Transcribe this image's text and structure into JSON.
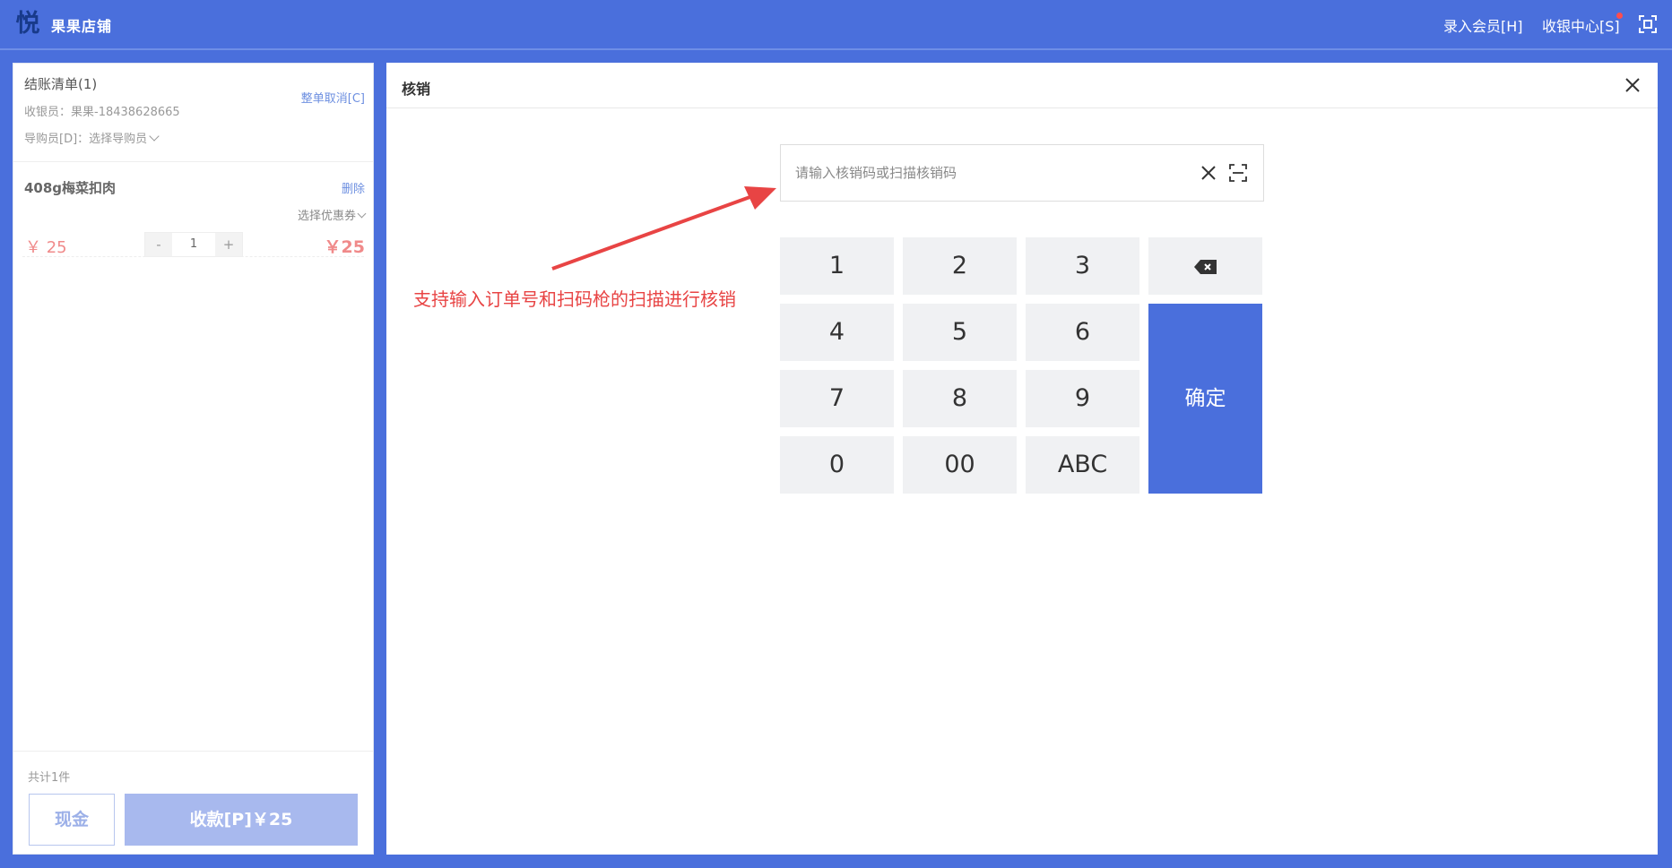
{
  "header": {
    "store_name": "果果店铺",
    "logo_char": "悦",
    "member_link": "录入会员[H]",
    "cashier_center": "收银中心[S]"
  },
  "checkout": {
    "title": "结账清单(1)",
    "cancel_all": "整单取消[C]",
    "cashier": "收银员：果果-18438628665",
    "guide": "导购员[D]：选择导购员",
    "items": [
      {
        "name": "408g梅菜扣肉",
        "delete": "删除",
        "coupon": "选择优惠券",
        "unit_price": "￥ 25",
        "quantity": "1",
        "minus": "-",
        "plus": "+",
        "total": "￥25"
      }
    ],
    "count": "共计1件",
    "cash_button": "现金",
    "pay_button": "收款[P]￥25"
  },
  "verify": {
    "title": "核销",
    "input_placeholder": "请输入核销码或扫描核销码",
    "input_value": "",
    "annotation": "支持输入订单号和扫码枪的扫描进行核销",
    "keys": [
      "1",
      "2",
      "3",
      "4",
      "5",
      "6",
      "7",
      "8",
      "9",
      "0",
      "00",
      "ABC"
    ],
    "confirm": "确定"
  },
  "colors": {
    "primary": "#4a6fdc",
    "accent_red": "#e84444",
    "price": "#f08a8a"
  },
  "icons": [
    "logo",
    "fullscreen-icon",
    "close-icon",
    "clear-icon",
    "scan-icon",
    "backspace-icon",
    "chevron-down-icon"
  ]
}
